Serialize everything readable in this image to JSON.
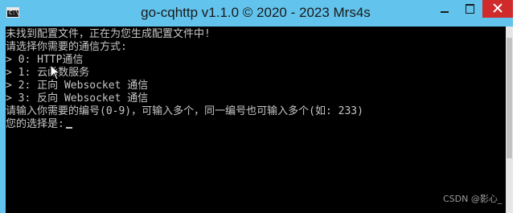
{
  "window": {
    "title": "go-cqhttp v1.1.0 © 2020 - 2023 Mrs4s",
    "icon": "cmd-console-icon",
    "icon_prompt": "C:\\"
  },
  "console": {
    "lines": [
      "未找到配置文件，正在为您生成配置文件中!",
      "请选择你需要的通信方式:",
      "> 0: HTTP通信",
      "> 1: 云函数服务",
      "> 2: 正向 Websocket 通信",
      "> 3: 反向 Websocket 通信",
      "请输入你需要的编号(0-9)，可输入多个，同一编号也可输入多个(如: 233)",
      "您的选择是:"
    ]
  },
  "watermark": "CSDN @影心_",
  "colors": {
    "titlebar": "#62c3ec",
    "console_bg": "#000000",
    "console_text": "#c6c6c6",
    "close_button": "#cf2b2b"
  }
}
